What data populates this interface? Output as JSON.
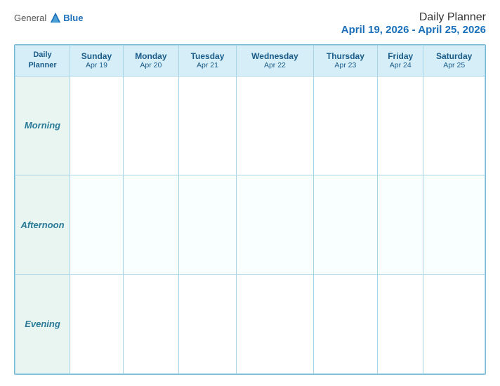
{
  "header": {
    "logo": {
      "general": "General",
      "blue": "Blue",
      "icon_color": "#1a6fba"
    },
    "title": "Daily Planner",
    "dates": "April 19, 2026 - April 25, 2026"
  },
  "calendar": {
    "first_col_label_line1": "Daily",
    "first_col_label_line2": "Planner",
    "columns": [
      {
        "day": "Sunday",
        "date": "Apr 19"
      },
      {
        "day": "Monday",
        "date": "Apr 20"
      },
      {
        "day": "Tuesday",
        "date": "Apr 21"
      },
      {
        "day": "Wednesday",
        "date": "Apr 22"
      },
      {
        "day": "Thursday",
        "date": "Apr 23"
      },
      {
        "day": "Friday",
        "date": "Apr 24"
      },
      {
        "day": "Saturday",
        "date": "Apr 25"
      }
    ],
    "rows": [
      {
        "label": "Morning"
      },
      {
        "label": "Afternoon"
      },
      {
        "label": "Evening"
      }
    ]
  }
}
